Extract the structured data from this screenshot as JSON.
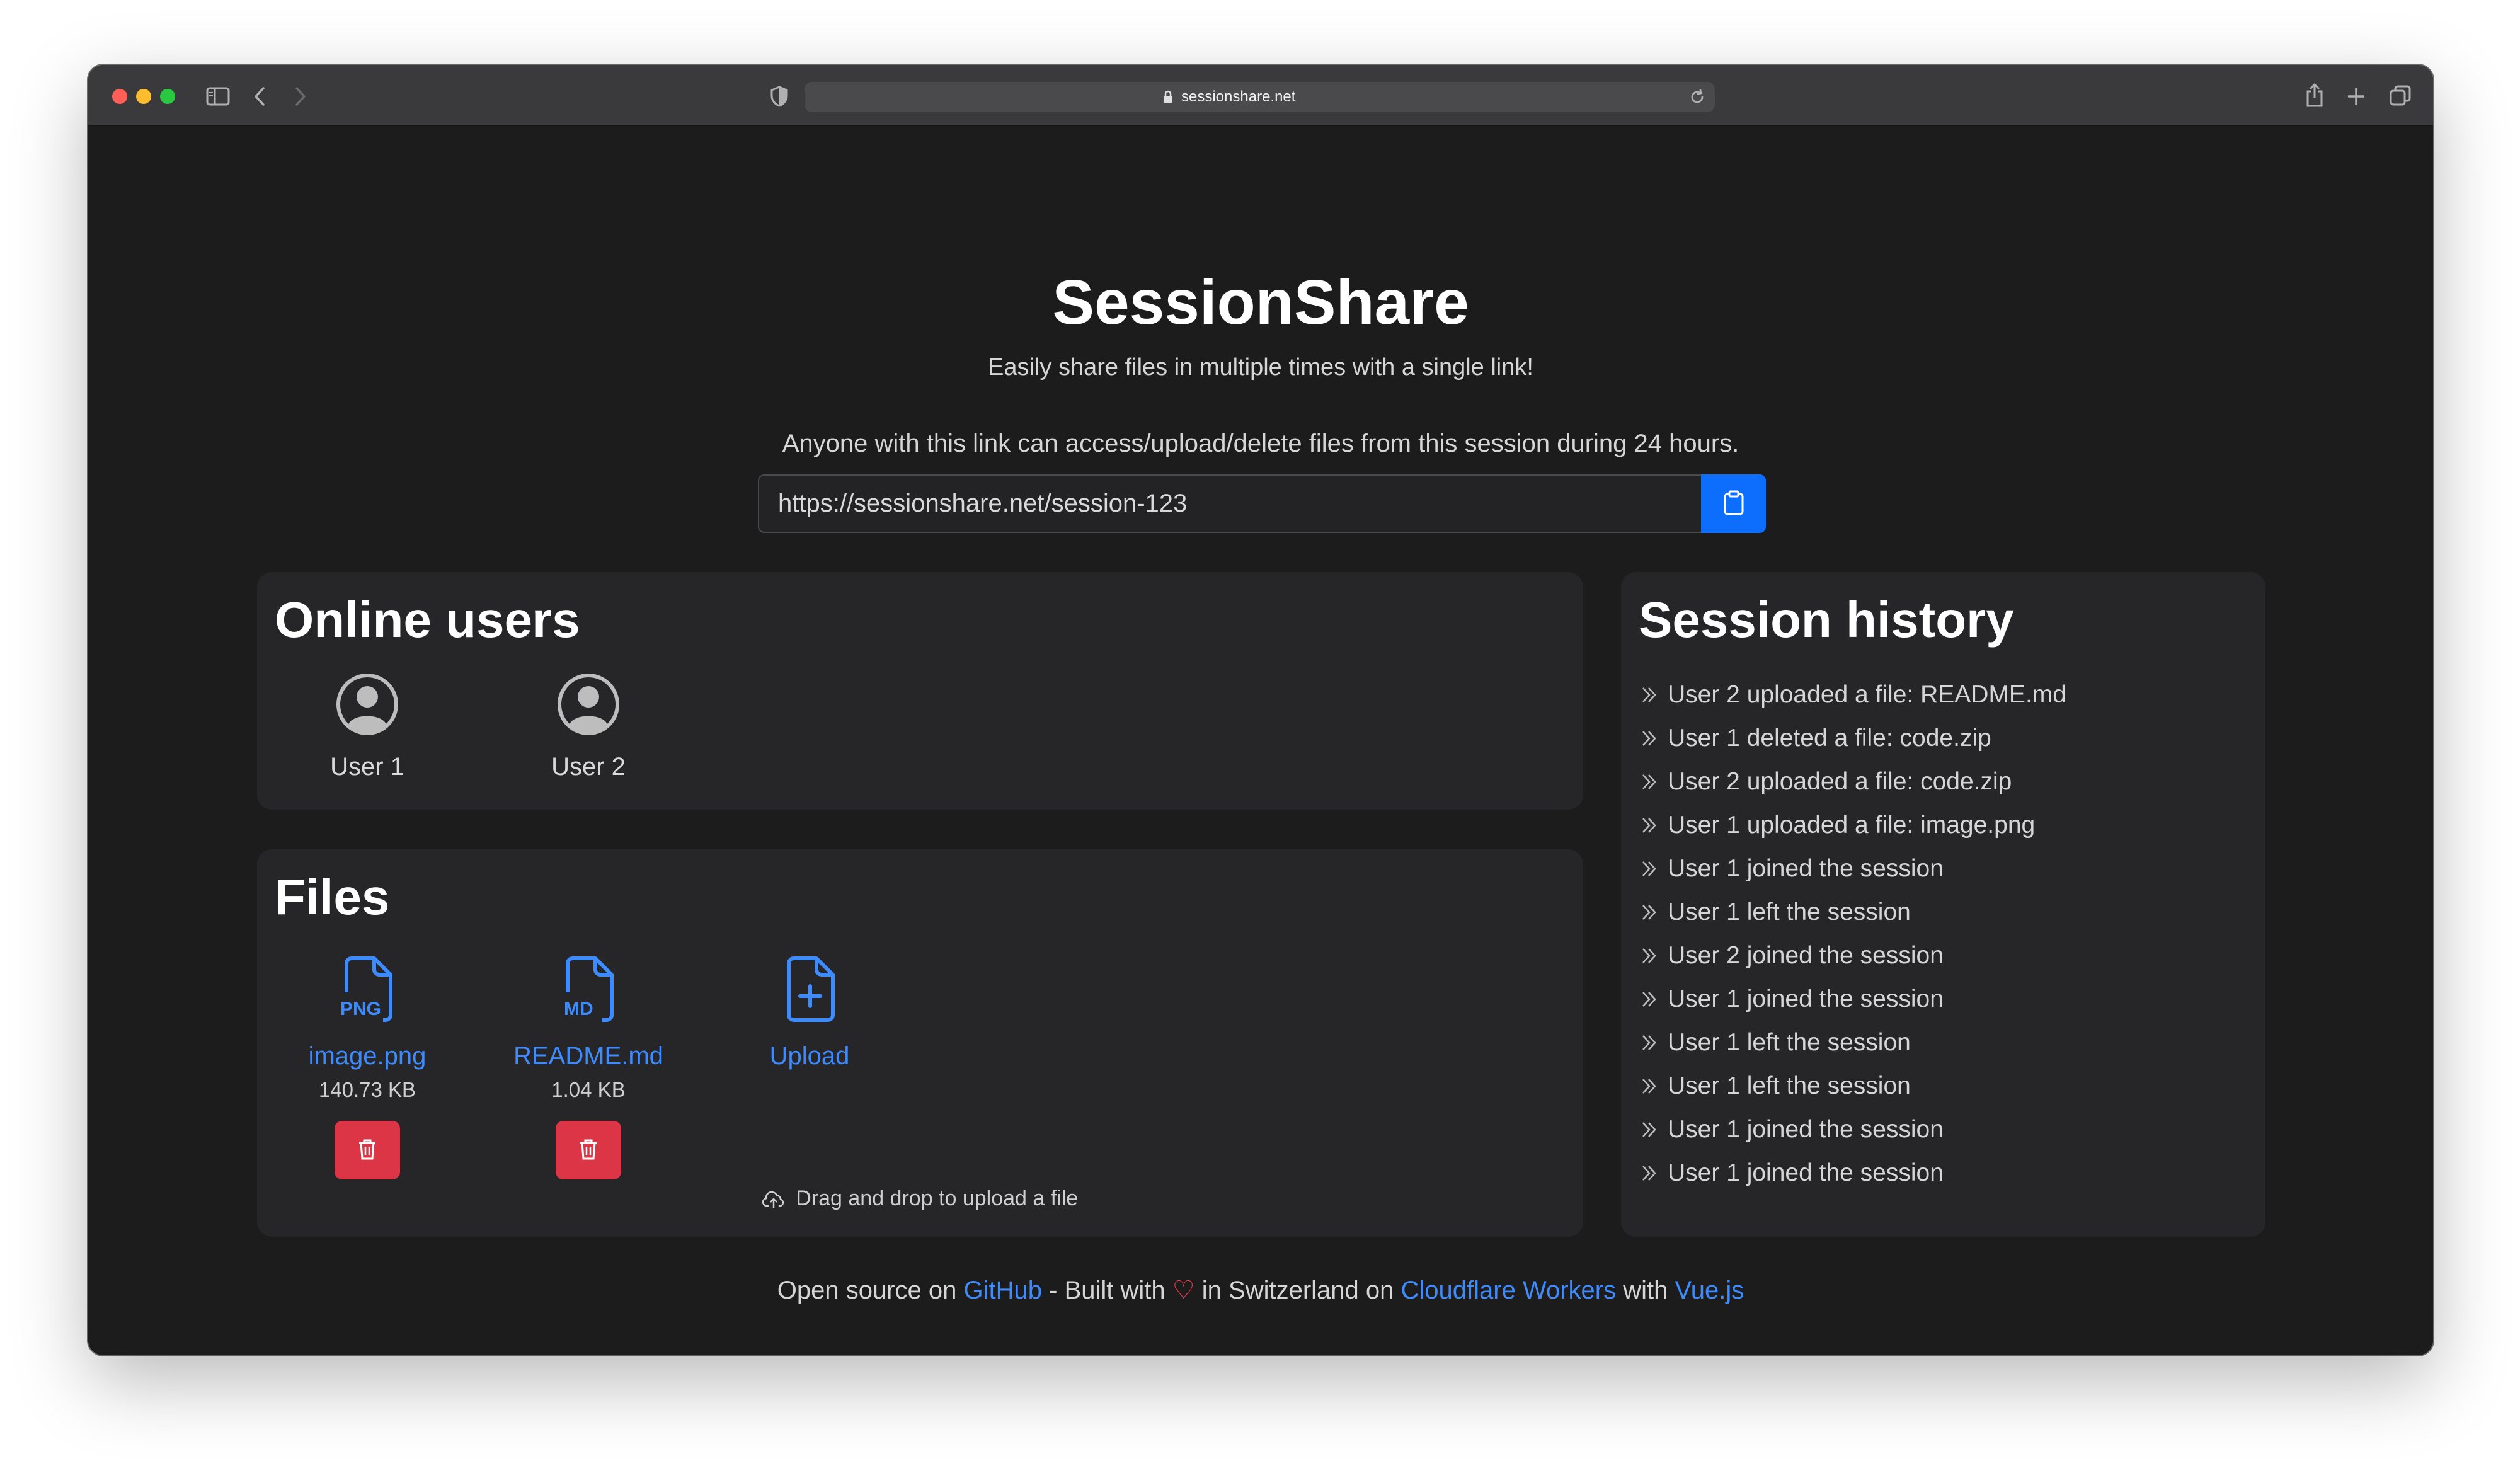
{
  "browser": {
    "address": "sessionshare.net"
  },
  "page": {
    "title": "SessionShare",
    "subtitle": "Easily share files in multiple times with a single link!",
    "notice": "Anyone with this link can access/upload/delete files from this session during 24 hours.",
    "link_value": "https://sessionshare.net/session-123"
  },
  "users": {
    "heading": "Online users",
    "list": [
      {
        "name": "User 1"
      },
      {
        "name": "User 2"
      }
    ]
  },
  "files": {
    "heading": "Files",
    "list": [
      {
        "name": "image.png",
        "size": "140.73 KB",
        "type_label": "PNG"
      },
      {
        "name": "README.md",
        "size": "1.04 KB",
        "type_label": "MD"
      }
    ],
    "upload_label": "Upload",
    "dropzone_text": "Drag and drop to upload a file"
  },
  "history": {
    "heading": "Session history",
    "items": [
      "User 2 uploaded a file: README.md",
      "User 1 deleted a file: code.zip",
      "User 2 uploaded a file: code.zip",
      "User 1 uploaded a file: image.png",
      "User 1 joined the session",
      "User 1 left the session",
      "User 2 joined the session",
      "User 1 joined the session",
      "User 1 left the session",
      "User 1 left the session",
      "User 1 joined the session",
      "User 1 joined the session"
    ]
  },
  "footer": {
    "text_1": "Open source on",
    "link_github": "GitHub",
    "text_2": "- Built with",
    "heart": "♡",
    "text_3": "in Switzerland on",
    "link_cloudflare": "Cloudflare Workers",
    "text_4": "with",
    "link_vue": "Vue.js"
  },
  "colors": {
    "accent": "#0d6efd",
    "link": "#3d8bfd",
    "danger": "#dc3545",
    "background": "#1c1c1d",
    "card": "#262628"
  }
}
